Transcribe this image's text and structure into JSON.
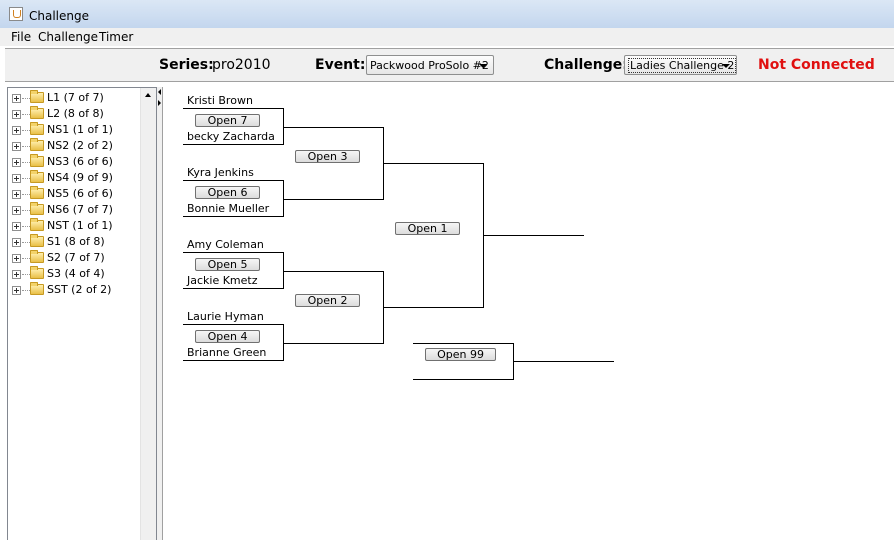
{
  "window": {
    "title": "Challenge"
  },
  "menu": [
    "File",
    "Challenge",
    "Timer"
  ],
  "toolbar": {
    "series_label": "Series:",
    "series_value": "pro2010",
    "event_label": "Event:",
    "event_value": "Packwood ProSolo #2",
    "challenge_label": "Challenge:",
    "challenge_value": "Ladies Challenge 2",
    "connection_status": "Not Connected",
    "status_color": "#e01010"
  },
  "tree": {
    "items": [
      {
        "label": "L1 (7 of 7)"
      },
      {
        "label": "L2 (8 of 8)"
      },
      {
        "label": "NS1 (1 of 1)"
      },
      {
        "label": "NS2 (2 of 2)"
      },
      {
        "label": "NS3 (6 of 6)"
      },
      {
        "label": "NS4 (9 of 9)"
      },
      {
        "label": "NS5 (6 of 6)"
      },
      {
        "label": "NS6 (7 of 7)"
      },
      {
        "label": "NST (1 of 1)"
      },
      {
        "label": "S1 (8 of 8)"
      },
      {
        "label": "S2 (7 of 7)"
      },
      {
        "label": "S3 (4 of 4)"
      },
      {
        "label": "SST (2 of 2)"
      }
    ]
  },
  "bracket": {
    "names": [
      "Kristi Brown",
      "becky Zacharda",
      "Kyra Jenkins",
      "Bonnie Mueller",
      "Amy Coleman",
      "Jackie Kmetz",
      "Laurie Hyman",
      "Brianne Green"
    ],
    "buttons": {
      "open7": "Open 7",
      "open6": "Open 6",
      "open5": "Open 5",
      "open4": "Open 4",
      "open3": "Open 3",
      "open2": "Open 2",
      "open1": "Open 1",
      "open99": "Open 99"
    }
  }
}
